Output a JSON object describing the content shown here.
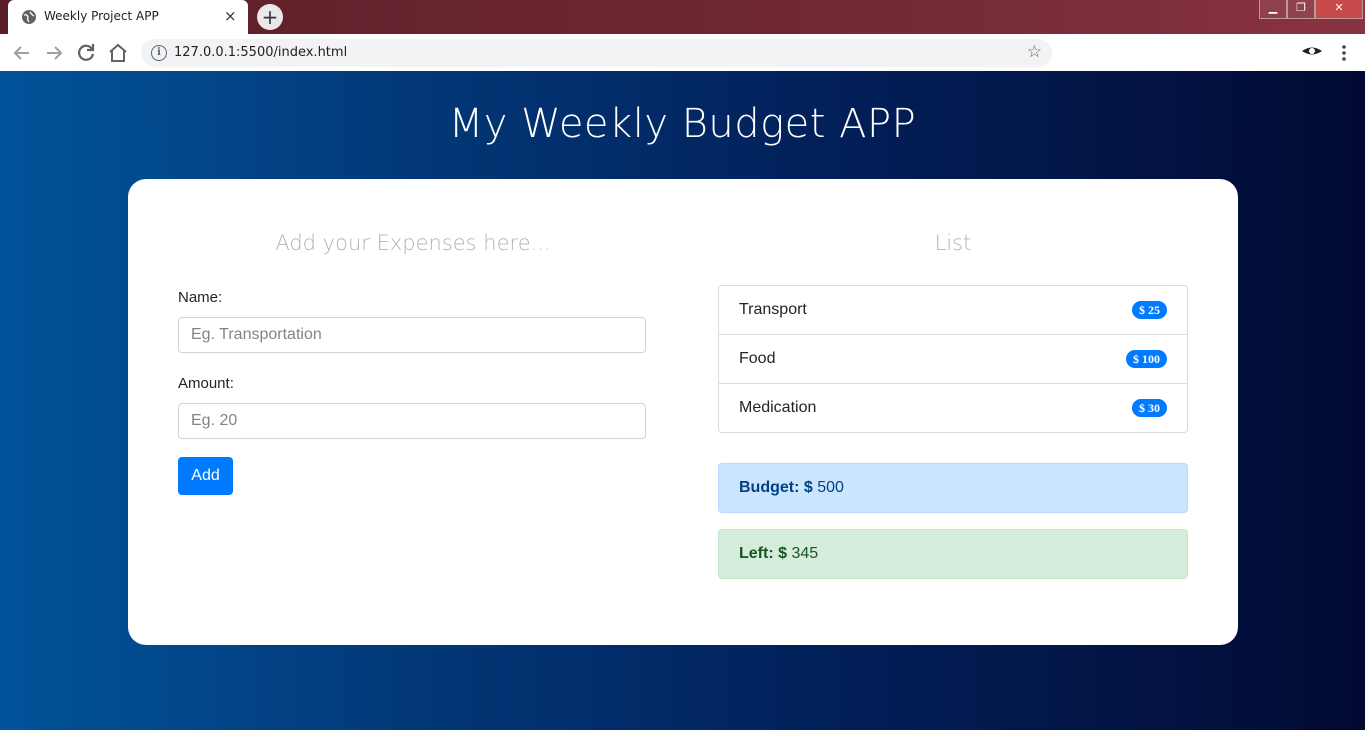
{
  "browser": {
    "tab_title": "Weekly Project APP",
    "tab_close": "×",
    "new_tab": "+",
    "url": "127.0.0.1:5500/index.html",
    "info_glyph": "i",
    "window_controls": [
      "▁",
      "❐",
      "✕"
    ]
  },
  "page": {
    "title": "My Weekly Budget APP"
  },
  "form": {
    "heading": "Add your Expenses here...",
    "name_label": "Name:",
    "name_placeholder": "Eg. Transportation",
    "amount_label": "Amount:",
    "amount_placeholder": "Eg. 20",
    "add_label": "Add"
  },
  "list": {
    "heading": "List",
    "items": [
      {
        "name": "Transport",
        "amount": "$ 25"
      },
      {
        "name": "Food",
        "amount": "$ 100"
      },
      {
        "name": "Medication",
        "amount": "$ 30"
      }
    ]
  },
  "summary": {
    "budget_label": "Budget: $",
    "budget_value": "500",
    "left_label": "Left: $",
    "left_value": "345"
  },
  "colors": {
    "accent": "#007bff",
    "bg_left": "#01539a",
    "bg_right": "#020a33"
  }
}
